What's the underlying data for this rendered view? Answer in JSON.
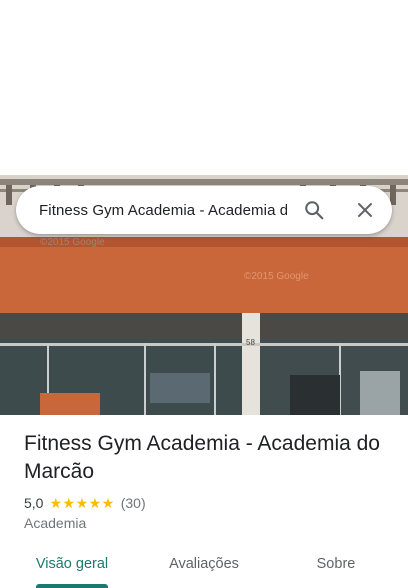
{
  "search": {
    "query": "Fitness Gym Academia - Academia do Marcão"
  },
  "photo": {
    "watermark_top": "©2015 Google",
    "watermark_mid": "©2015 Google",
    "street_number": "58",
    "colors": {
      "facade": "#c9663a",
      "sky": "#d8d4cf",
      "glass": "#3b4a4a"
    }
  },
  "place": {
    "title": "Fitness Gym Academia - Academia do Marcão",
    "rating": "5,0",
    "stars": "★★★★★",
    "star_value": 5,
    "review_count": "(30)",
    "category": "Academia"
  },
  "tabs": [
    {
      "label": "Visão geral",
      "active": true
    },
    {
      "label": "Avaliações",
      "active": false
    },
    {
      "label": "Sobre",
      "active": false
    }
  ],
  "colors": {
    "accent": "#1a7a6e",
    "star": "#fbbc04"
  }
}
